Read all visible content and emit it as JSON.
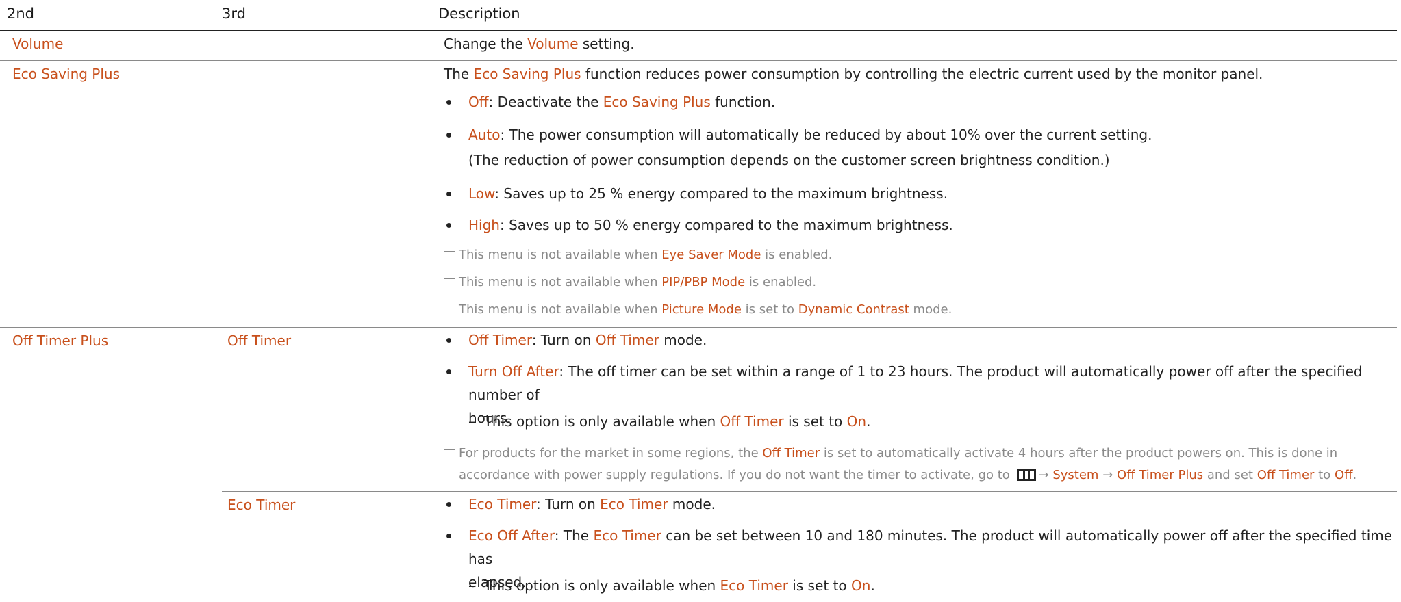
{
  "headers": {
    "col2": "2nd",
    "col3": "3rd",
    "col4": "Description"
  },
  "volume": {
    "label": "Volume",
    "desc_pre": "Change the ",
    "desc_hl": "Volume",
    "desc_post": " setting."
  },
  "eco": {
    "label": "Eco Saving Plus",
    "intro_hl": "Eco Saving Plus",
    "intro_post": " function reduces power consumption by controlling the electric current used by the monitor panel.",
    "intro_pre": "The ",
    "off_hl": "Off",
    "off_text": ": Deactivate the ",
    "off_hl2": "Eco Saving Plus",
    "off_post": " function.",
    "auto_hl": "Auto",
    "auto_text": ": The power consumption will automatically be reduced by about 10% over the current setting.",
    "auto_sub": "(The reduction of power consumption depends on the customer screen brightness condition.)",
    "low_hl": "Low",
    "low_text": ": Saves up to 25 % energy compared to the maximum brightness.",
    "high_hl": "High",
    "high_text": ": Saves up to 50 % energy compared to the maximum brightness.",
    "note1_pre": "This menu is not available when ",
    "note1_hl": "Eye Saver Mode",
    "note1_post": " is enabled.",
    "note2_pre": "This menu is not available when ",
    "note2_hl": "PIP/PBP Mode",
    "note2_post": " is enabled.",
    "note3_pre": "This menu is not available when ",
    "note3_hl": "Picture Mode",
    "note3_mid": " is set to ",
    "note3_hl2": "Dynamic Contrast",
    "note3_post": " mode."
  },
  "offtimer": {
    "label": "Off Timer Plus",
    "sub_label": "Off Timer",
    "b1_hl": "Off Timer",
    "b1_text": ": Turn on ",
    "b1_hl2": "Off Timer",
    "b1_post": " mode.",
    "b2_hl": "Turn Off After",
    "b2_text": ": The off timer can be set within a range of 1 to 23 hours. The product will automatically power off after the specified number of",
    "b2_text2": "hours.",
    "dash_pre": "This option is only available when ",
    "dash_hl": "Off Timer",
    "dash_mid": " is set to ",
    "dash_hl2": "On",
    "dash_post": ".",
    "note_pre": "For products for the market in some regions, the ",
    "note_hl": "Off Timer",
    "note_post": " is set to automatically activate 4 hours after the product powers on. This is done in",
    "note2_pre": "accordance with power supply regulations. If you do not want the timer to activate, go to ",
    "note2_arrow1": "→",
    "note2_hl1": "System",
    "note2_arrow2": "→",
    "note2_hl2": "Off Timer Plus",
    "note2_mid": " and set ",
    "note2_hl3": "Off Timer",
    "note2_to": " to ",
    "note2_hl4": "Off",
    "note2_end": "."
  },
  "ecotimer": {
    "sub_label": "Eco Timer",
    "b1_hl": "Eco Timer",
    "b1_text": ": Turn on ",
    "b1_hl2": "Eco Timer",
    "b1_post": " mode.",
    "b2_hl": "Eco Off After",
    "b2_text": ": The ",
    "b2_hl2": "Eco Timer",
    "b2_post": " can be set between 10 and 180 minutes. The product will automatically power off after the specified time has",
    "b2_text2": "elapsed.",
    "dash_pre": "This option is only available when ",
    "dash_hl": "Eco Timer",
    "dash_mid": " is set to ",
    "dash_hl2": "On",
    "dash_post": "."
  },
  "colors": {
    "highlight": "#c8501c",
    "text": "#222222",
    "note": "#8a8a8a"
  },
  "icons": {
    "menu": "menu-icon",
    "bullet": "bullet-icon",
    "dash": "note-dash-icon"
  }
}
